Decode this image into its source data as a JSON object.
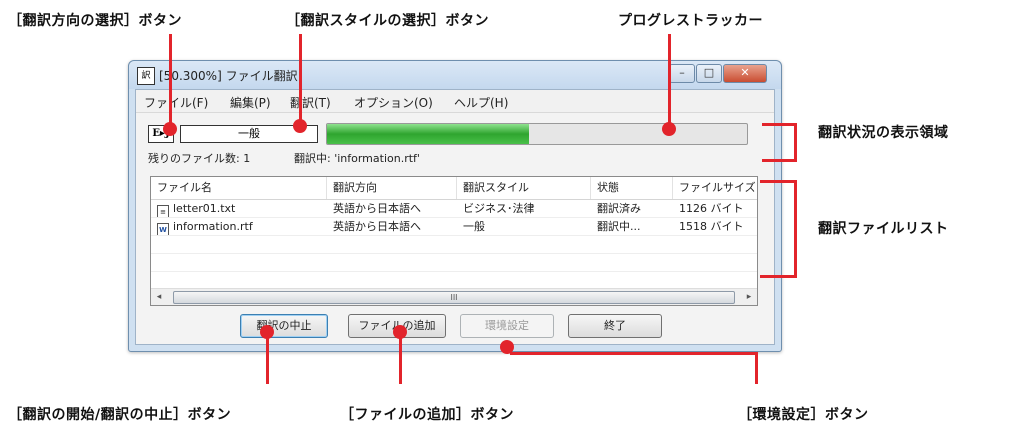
{
  "callouts": {
    "direction_button": "［翻訳方向の選択］ボタン",
    "style_button": "［翻訳スタイルの選択］ボタン",
    "progress_tracker": "プログレストラッカー",
    "status_area": "翻訳状況の表示領域",
    "file_list": "翻訳ファイルリスト",
    "start_stop_button": "［翻訳の開始/翻訳の中止］ボタン",
    "add_file_button": "［ファイルの追加］ボタン",
    "settings_button": "［環境設定］ボタン"
  },
  "window": {
    "title": "[50.300%] ファイル翻訳",
    "controls": {
      "minimize": "–",
      "maximize": "□",
      "close": "✕"
    }
  },
  "menu": [
    "ファイル(F)",
    "編集(P)",
    "翻訳(T)",
    "オプション(O)",
    "ヘルプ(H)"
  ],
  "toolbar": {
    "direction_label": "E▸J",
    "style_value": "一般",
    "progress": 0.48
  },
  "status": {
    "remaining": "残りのファイル数:  1",
    "translating": "翻訳中:  'information.rtf'"
  },
  "file_list": {
    "columns": [
      "ファイル名",
      "翻訳方向",
      "翻訳スタイル",
      "状態",
      "ファイルサイズ"
    ],
    "rows": [
      {
        "icon": "text-file-icon",
        "name": "letter01.txt",
        "direction": "英語から日本語へ",
        "style": "ビジネス･法律",
        "state": "翻訳済み",
        "size": "1126 バイト"
      },
      {
        "icon": "word-file-icon",
        "name": "information.rtf",
        "direction": "英語から日本語へ",
        "style": "一般",
        "state": "翻訳中...",
        "size": "1518 バイト"
      }
    ],
    "scroll_left": "◂",
    "scroll_right": "▸",
    "scroll_grip": "III"
  },
  "buttons": {
    "stop": "翻訳の中止",
    "add_file": "ファイルの追加",
    "settings": "環境設定",
    "exit": "終了"
  },
  "colors": {
    "annotation": "#e2242b",
    "progress_fill": "#2fa52f"
  }
}
